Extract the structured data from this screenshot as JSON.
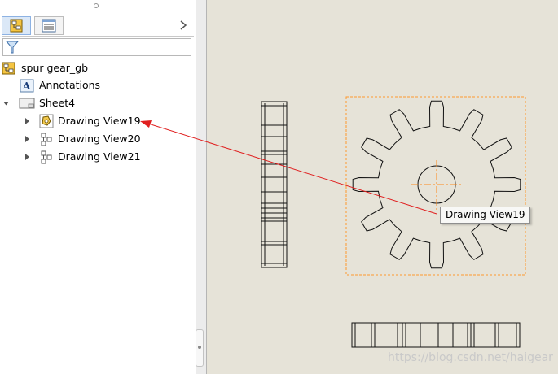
{
  "tree": {
    "root": "spur gear_gb",
    "annotations": "Annotations",
    "sheet": "Sheet4",
    "views": [
      "Drawing View19",
      "Drawing View20",
      "Drawing View21"
    ]
  },
  "tooltip": "Drawing View19",
  "watermark": "https://blog.csdn.net/haigear",
  "icons": {
    "feature_tab": "feature-manager-icon",
    "property_tab": "property-manager-icon",
    "filter": "filter-icon",
    "more": "chevron-right-icon"
  },
  "colors": {
    "sheet_background": "#e6e3d8",
    "selection_box": "#ff9a2e",
    "leader_arrow": "#e02020",
    "tab_active": "#dbe8f7"
  }
}
